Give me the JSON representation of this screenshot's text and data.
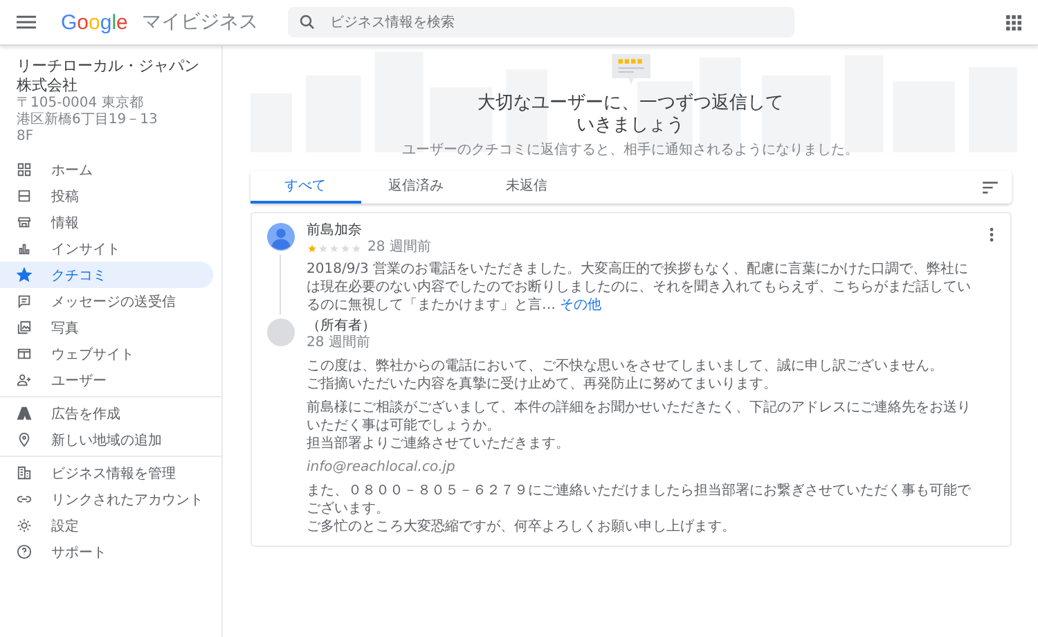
{
  "header": {
    "logo": "Google",
    "product": "マイビジネス",
    "search": {
      "placeholder": "ビジネス情報を検索"
    }
  },
  "business": {
    "name": "リーチローカル・ジャパン株式会社",
    "address": [
      "〒105-0004 東京都",
      "港区新橋6丁目19－13",
      "8F"
    ]
  },
  "sidebar": {
    "sections": [
      {
        "items": [
          {
            "label": "ホーム",
            "selected": false
          },
          {
            "label": "投稿",
            "selected": false
          },
          {
            "label": "情報",
            "selected": false
          },
          {
            "label": "インサイト",
            "selected": false
          },
          {
            "label": "クチコミ",
            "selected": true
          },
          {
            "label": "メッセージの送受信",
            "selected": false
          },
          {
            "label": "写真",
            "selected": false
          },
          {
            "label": "ウェブサイト",
            "selected": false
          },
          {
            "label": "ユーザー",
            "selected": false
          }
        ]
      },
      {
        "items": [
          {
            "label": "広告を作成",
            "selected": false
          },
          {
            "label": "新しい地域の追加",
            "selected": false
          }
        ]
      },
      {
        "items": [
          {
            "label": "ビジネス情報を管理",
            "selected": false
          },
          {
            "label": "リンクされたアカウント",
            "selected": false
          },
          {
            "label": "設定",
            "selected": false
          },
          {
            "label": "サポート",
            "selected": false
          }
        ]
      }
    ]
  },
  "hero": {
    "title": "大切なユーザーに、一つずつ返信していきましょう",
    "subtitle": "ユーザーのクチコミに返信すると、相手に通知されるようになりました。"
  },
  "tabs": [
    {
      "label": "すべて",
      "selected": true
    },
    {
      "label": "返信済み",
      "selected": false
    },
    {
      "label": "未返信",
      "selected": false
    }
  ],
  "reviews": [
    {
      "author": "前島加奈",
      "stars": 1,
      "time": "28 週間前",
      "text": "2018/9/3 営業のお電話をいただきました。大変高圧的で挨拶もなく、配慮に言葉にかけた口調で、弊社には現在必要のない内容でしたのでお断りしましたのに、それを聞き入れてもらえず、こちらがまだ話しているのに無視して「またかけます」と言…",
      "more": "その他",
      "reply": {
        "author": "（所有者）",
        "time": "28 週間前",
        "paragraphs": [
          {
            "kind": "text",
            "lines": [
              "この度は、弊社からの電話において、ご不快な思いをさせてしまいまして、誠に申し訳ございません。",
              "ご指摘いただいた内容を真摯に受け止めて、再発防止に努めてまいります。"
            ]
          },
          {
            "kind": "text",
            "lines": [
              "前島様にご相談がございまして、本件の詳細をお聞かせいただきたく、下記のアドレスにご連絡先をお送りいただく事は可能でしょうか。",
              "担当部署よりご連絡させていただきます。"
            ]
          },
          {
            "kind": "email",
            "lines": [
              "info@reachlocal.co.jp"
            ]
          },
          {
            "kind": "text",
            "lines": [
              "また、０８００－８０５－６２７９にご連絡いただけましたら担当部署にお繋ぎさせていただく事も可能でございます。",
              "ご多忙のところ大変恐縮ですが、何卒よろしくお願い申し上げます。"
            ]
          }
        ]
      }
    }
  ]
}
